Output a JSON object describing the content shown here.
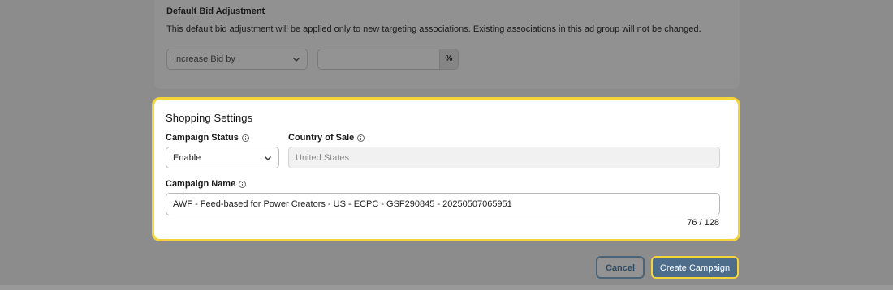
{
  "bid_adjustment": {
    "title": "Default Bid Adjustment",
    "description": "This default bid adjustment will be applied only to new targeting associations. Existing associations in this ad group will not be changed.",
    "select_value": "Increase Bid by",
    "input_value": "",
    "unit": "%"
  },
  "shopping_settings": {
    "title": "Shopping Settings",
    "campaign_status": {
      "label": "Campaign Status",
      "value": "Enable"
    },
    "country_of_sale": {
      "label": "Country of Sale",
      "value": "United States"
    },
    "campaign_name": {
      "label": "Campaign Name",
      "value": "AWF - Feed-based for Power Creators - US - ECPC - GSF290845 - 20250507065951",
      "counter": "76 / 128"
    }
  },
  "actions": {
    "cancel": "Cancel",
    "create": "Create Campaign"
  },
  "colors": {
    "highlight": "#f3d43a",
    "primary": "#4d6d8a",
    "overlay": "#8c8c8c"
  }
}
